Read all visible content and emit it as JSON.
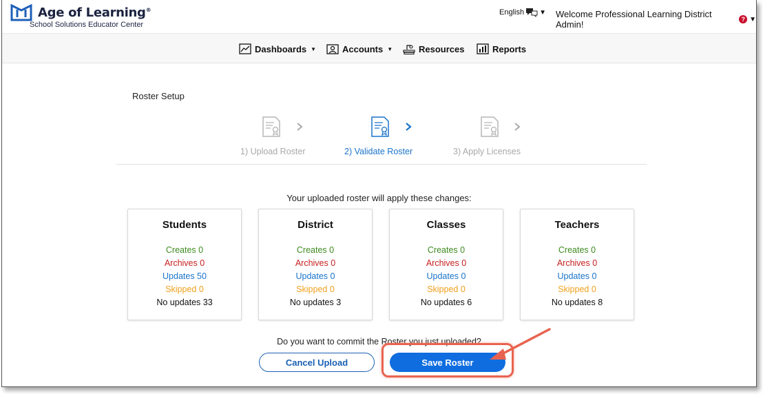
{
  "header": {
    "brand_title": "Age of Learning",
    "brand_trademark": "®",
    "brand_subtitle": "School Solutions Educator Center",
    "language": "English",
    "welcome": "Welcome Professional Learning District Admin!",
    "help_badge": "?"
  },
  "nav": {
    "items": [
      {
        "label": "Dashboards",
        "icon": "chart-icon",
        "has_dropdown": true
      },
      {
        "label": "Accounts",
        "icon": "accounts-icon",
        "has_dropdown": true
      },
      {
        "label": "Resources",
        "icon": "books-icon",
        "has_dropdown": false
      },
      {
        "label": "Reports",
        "icon": "bar-chart-icon",
        "has_dropdown": false
      }
    ]
  },
  "page": {
    "title": "Roster Setup",
    "steps": [
      {
        "label": "1) Upload Roster",
        "active": false
      },
      {
        "label": "2) Validate Roster",
        "active": true
      },
      {
        "label": "3) Apply Licenses",
        "active": false
      }
    ],
    "changes_intro": "Your uploaded roster will apply these changes:",
    "cards": [
      {
        "title": "Students",
        "creates": "Creates 0",
        "archives": "Archives 0",
        "updates": "Updates 50",
        "skipped": "Skipped 0",
        "no_updates": "No updates 33"
      },
      {
        "title": "District",
        "creates": "Creates 0",
        "archives": "Archives 0",
        "updates": "Updates 0",
        "skipped": "Skipped 0",
        "no_updates": "No updates 3"
      },
      {
        "title": "Classes",
        "creates": "Creates 0",
        "archives": "Archives 0",
        "updates": "Updates 0",
        "skipped": "Skipped 0",
        "no_updates": "No updates 6"
      },
      {
        "title": "Teachers",
        "creates": "Creates 0",
        "archives": "Archives 0",
        "updates": "Updates 0",
        "skipped": "Skipped 0",
        "no_updates": "No updates 8"
      }
    ],
    "commit_question": "Do you want to commit the Roster you just uploaded?",
    "cancel_label": "Cancel Upload",
    "save_label": "Save Roster"
  },
  "colors": {
    "creates": "#3c8a1e",
    "archives": "#c81e1e",
    "updates": "#1a73c9",
    "skipped": "#f0a01e",
    "primary": "#0f6de0",
    "highlight": "#e8634f"
  }
}
